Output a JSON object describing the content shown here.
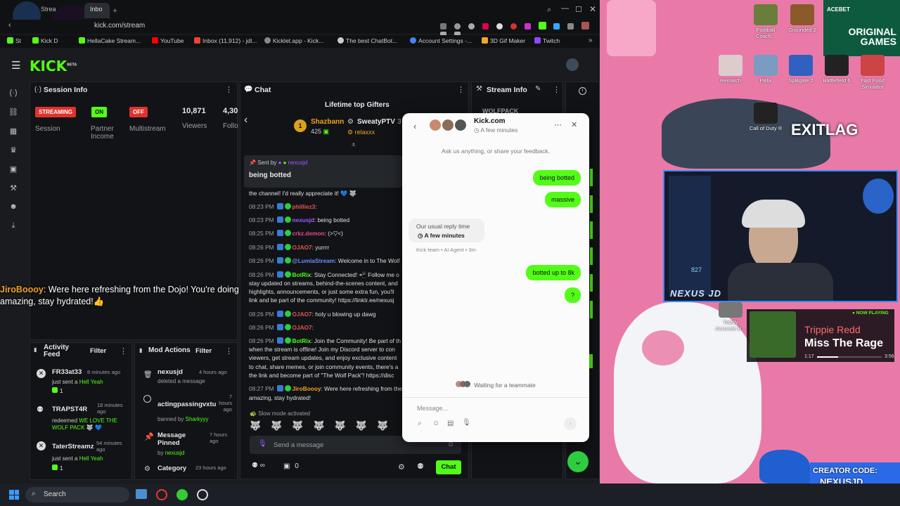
{
  "browser": {
    "tabs": [
      {
        "label": "Strea",
        "active": false
      },
      {
        "label": "Kick D",
        "active": false
      },
      {
        "label": "Inbo",
        "active": true
      }
    ],
    "url": "kick.com/stream",
    "bookmarks": [
      "St",
      "Kick D",
      "HellaCake Stream...",
      "YouTube",
      "Inbox (11,912) - jdl...",
      "Kicklet.app - Kick...",
      "The best ChatBot...",
      "Account Settings -...",
      "3D Gif Maker",
      "Twitch"
    ]
  },
  "kick": {
    "logo": "KICK",
    "logo_sup": "BETA"
  },
  "session": {
    "title": "Session Info",
    "streaming": "STREAMING",
    "on": "ON",
    "off": "OFF",
    "session_label": "Session",
    "partner_label": "Partner Income",
    "multistream_label": "Multistream",
    "viewers_value": "10,871",
    "viewers_label": "Viewers",
    "followers_value": "4,30",
    "followers_label": "Follo"
  },
  "overlay_message": {
    "user": "JiroBoooy",
    "text": ": Were here refreshing from the Dojo! You're doing amazing, stay hydrated!"
  },
  "activity": {
    "title": "Activity Feed",
    "filter": "Filter",
    "items": [
      {
        "user": "FR33at33",
        "time": "8 minutes ago",
        "line1": "just sent a",
        "highlight": "Hell Yeah",
        "count": "1"
      },
      {
        "user": "TRAPST4R",
        "time": "18 minutes ago",
        "line1": "redeemed",
        "highlight": "WE LOVE THE WOLF PACK",
        "count": ""
      },
      {
        "user": "TaterStreamz",
        "time": "54 minutes ago",
        "line1": "just sent a",
        "highlight": "Hell Yeah",
        "count": "1"
      }
    ]
  },
  "mod": {
    "title": "Mod Actions",
    "filter": "Filter",
    "items": [
      {
        "name": "nexusjd",
        "time": "4 hours ago",
        "sub": "deleted a message",
        "by": ""
      },
      {
        "name": "actingpassingvxtu",
        "time": "7 hours ago",
        "sub": "banned by",
        "by": "Sharkyyy"
      },
      {
        "name": "Message Pinned",
        "time": "7 hours ago",
        "sub": "by",
        "by": "nexusjd"
      },
      {
        "name": "Category",
        "time": "23 hours ago",
        "sub": "",
        "by": ""
      }
    ]
  },
  "chat": {
    "title": "Chat",
    "gifters_title": "Lifetime top Gifters",
    "gifter1_name": "Shazbann",
    "gifter1_amount": "425",
    "gifter2_name": "SweatyPTV",
    "gifter2_sub": "relaxxx",
    "gifter2_amount": "3",
    "pinned_by": "Sent by",
    "pinned_user": "nexusjd",
    "pinned_text": "being botted",
    "lines": [
      {
        "time": "",
        "user": "",
        "color": "#e0e0e0",
        "text": "the channel! I'd really appreciate it! 💙 🐺"
      },
      {
        "time": "08:23 PM",
        "user": "philliez3",
        "color": "#e25555",
        "text": ":"
      },
      {
        "time": "08:23 PM",
        "user": "nexusjd",
        "color": "#9b59ff",
        "text": ": being botted"
      },
      {
        "time": "08:25 PM",
        "user": "crkz.demon",
        "color": "#e04a8a",
        "text": ": (>▽<)"
      },
      {
        "time": "08:26 PM",
        "user": "OJAO7",
        "color": "#e25555",
        "text": ": yurrrr"
      },
      {
        "time": "08:26 PM",
        "user": "@LumiaStream",
        "color": "#6a8dff",
        "text": ": Welcome in to The Wolf"
      },
      {
        "time": "08:26 PM",
        "user": "BotRix",
        "color": "#53fc18",
        "text": ": Stay Connected! 📲 Follow me o"
      },
      {
        "time": "",
        "user": "",
        "color": "#e0e0e0",
        "text": "stay updated on streams, behind-the-scenes content, and"
      },
      {
        "time": "",
        "user": "",
        "color": "#e0e0e0",
        "text": "highlights, announcements, or just some extra fun, you'll"
      },
      {
        "time": "",
        "user": "",
        "color": "#e0e0e0",
        "text": "link and be part of the community! https://linktr.ee/nexusj"
      },
      {
        "time": "08:26 PM",
        "user": "OJAO7",
        "color": "#e25555",
        "text": ": holy u blowing up dawg"
      },
      {
        "time": "08:26 PM",
        "user": "OJAO7",
        "color": "#e25555",
        "text": ":"
      },
      {
        "time": "08:26 PM",
        "user": "BotRix",
        "color": "#53fc18",
        "text": ": Join the Community! Be part of th"
      },
      {
        "time": "",
        "user": "",
        "color": "#e0e0e0",
        "text": "when the stream is offline! Join my Discord server to con"
      },
      {
        "time": "",
        "user": "",
        "color": "#e0e0e0",
        "text": "viewers, get stream updates, and enjoy exclusive content"
      },
      {
        "time": "",
        "user": "",
        "color": "#e0e0e0",
        "text": "to chat, share memes, or join community events, there's a"
      },
      {
        "time": "",
        "user": "",
        "color": "#e0e0e0",
        "text": "the link and become part of \"The Wolf Pack\"! https://disc"
      },
      {
        "time": "08:27 PM",
        "user": "JiroBoooy",
        "color": "#f0a020",
        "text": ": Were here refreshing from the Dojo! Y"
      },
      {
        "time": "",
        "user": "",
        "color": "#e0e0e0",
        "text": "amazing, stay hydrated!"
      }
    ],
    "slow_mode": "Slow mode activated",
    "input_placeholder": "Send a message",
    "count_infinity": "∞",
    "count_zero": "0",
    "chat_button": "Chat"
  },
  "stream_info": {
    "title": "Stream Info",
    "tag": "WOLFPACK"
  },
  "widget": {
    "title": "Kick.com",
    "status": "A few minutes",
    "intro": "Ask us anything, or share your feedback.",
    "out1": "being botted",
    "out2": "massive",
    "reply_label": "Our usual reply time",
    "reply_value": "A few minutes",
    "agent": "Kick team • AI Agent • 3m",
    "out3": "botted up to 8k",
    "out4": "?",
    "waiting": "Waiting for a teammate",
    "input_placeholder": "Message..."
  },
  "desktop": {
    "icons": [
      {
        "label": "Football Coach..."
      },
      {
        "label": "Grounded 2"
      },
      {
        "label": "Rematch"
      },
      {
        "label": "PBlix"
      },
      {
        "label": "Splitgate 2"
      },
      {
        "label": "Battlefield 6"
      },
      {
        "label": "Fast Food Simulator"
      },
      {
        "label": "Call of Duty ®"
      },
      {
        "label": "Totally Accurate B..."
      }
    ],
    "ad_brand": "ACEBET",
    "ad_text": "ORIGINAL GAMES",
    "exit_lag": "EXITLAG",
    "webcam_name": "NEXUS JD",
    "now_playing_label": "NOW PLAYING",
    "artist": "Trippie Redd",
    "song": "Miss The Rage",
    "time_elapsed": "1:17",
    "time_total": "3:56",
    "track_progress": 0.33,
    "creator_label": "CREATOR CODE:",
    "creator_code": "NEXUSJD",
    "clock": "827"
  },
  "taskbar": {
    "search": "Search"
  }
}
